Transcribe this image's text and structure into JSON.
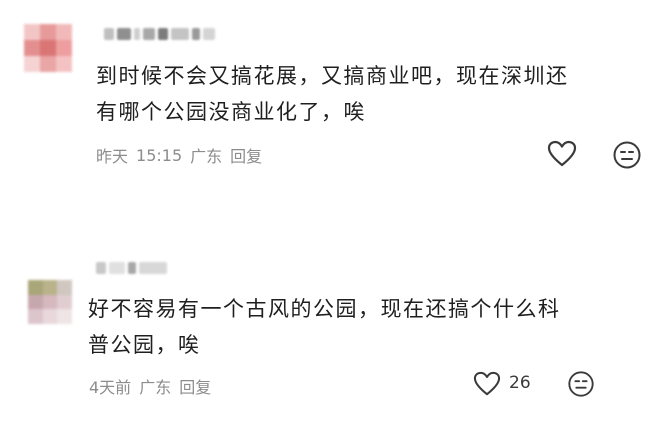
{
  "comments": [
    {
      "text_lines": [
        "到时候不会又搞花展，又搞商业吧，现在深圳还",
        "有哪个公园没商业化了，唉"
      ],
      "date": "昨天",
      "time": "15:15",
      "location": "广东",
      "reply_label": "回复",
      "like_count": ""
    },
    {
      "text_lines": [
        "好不容易有一个古风的公园，现在还搞个什么科",
        "普公园，唉"
      ],
      "date": "4天前",
      "time": "",
      "location": "广东",
      "reply_label": "回复",
      "like_count": "26"
    }
  ],
  "icons": {
    "like": "heart-outline-icon",
    "dislike": "neutral-face-icon"
  },
  "colors": {
    "text": "#1f1f1f",
    "meta": "#8c8c8c",
    "icon_stroke": "#3a3a3a"
  }
}
